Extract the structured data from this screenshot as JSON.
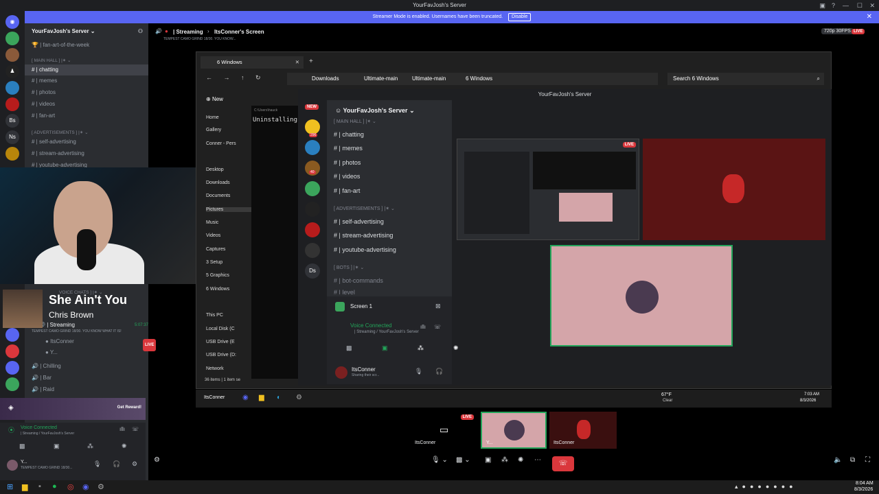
{
  "window": {
    "title": "YourFavJosh's Server"
  },
  "banner": {
    "text": "Streamer Mode is enabled. Usernames have been truncated.",
    "button": "Disable"
  },
  "rail": {
    "items": [
      "Bs",
      "Ns"
    ]
  },
  "sidebar": {
    "server_name": "YourFavJosh's Server",
    "top_channel": "fan-art-of-the-week",
    "cat_main": "[ MAIN HALL ] |✶ ⌄",
    "channels_main": [
      "chatting",
      "memes",
      "photos",
      "videos",
      "fan-art"
    ],
    "cat_ads": "[ ADVERTISEMENTS ] |✶ ⌄",
    "channels_ads": [
      "self-advertising",
      "stream-advertising",
      "youtube-advertising"
    ],
    "cat_voice": "VOICE CHATS ] |✶ ⌄",
    "voice_streaming": "| Streaming",
    "voice_streaming_time": "5:07:37",
    "voice_streaming_sub": "TEMPEST CAMO GRIND 18/30. YOU KNOW WHAT IT IS!",
    "voice_user1": "ItsConner",
    "voice_user2": "Y...",
    "voice_others": [
      "| Chilling",
      "| Bar",
      "| Raid"
    ],
    "get_reward": "Get Reward!",
    "voice_connected": "Voice Connected",
    "voice_sub": "| Streaming / YourFavJosh's Server",
    "user_name": "Y...",
    "user_status": "TEMPEST CAMO GRIND 18/30..."
  },
  "topbar": {
    "channel": "| Streaming",
    "screen": "ItsConner's Screen",
    "sub": "TEMPEST CAMO GRIND 18/30. YOU KNOW...",
    "quality": "720p 30FPS",
    "live": "LIVE"
  },
  "nowplaying": {
    "title": "She Ain't You",
    "artist": "Chris Brown"
  },
  "explorer": {
    "tab": "6 Windows",
    "crumbs": [
      "Downloads",
      "Ultimate-main",
      "Ultimate-main",
      "6 Windows"
    ],
    "search": "Search 6 Windows",
    "new": "New",
    "nav": [
      "Home",
      "Gallery",
      "Conner - Pers",
      "Desktop",
      "Downloads",
      "Documents",
      "Pictures",
      "Music",
      "Videos",
      "Captures",
      "3 Setup",
      "5 Graphics",
      "6 Windows",
      "This PC",
      "Local Disk (C",
      "USB Drive (E",
      "USB Drive (D:",
      "Network"
    ],
    "status": "36 items  |  1 item se",
    "terminal_path": "C:\\Users\\hauck",
    "terminal": "Uninstalling"
  },
  "inner": {
    "title": "YourFavJosh's Server",
    "server_name": "YourFavJosh's Server",
    "new_badge": "NEW",
    "badge1": "296",
    "badge2": "40",
    "rail_text": "Ds",
    "cat_main": "[ MAIN HALL ] |✶ ⌄",
    "channels_main": [
      "chatting",
      "memes",
      "photos",
      "videos",
      "fan-art"
    ],
    "cat_ads": "[ ADVERTISEMENTS ] |✶ ⌄",
    "channels_ads": [
      "self-advertising",
      "stream-advertising",
      "youtube-advertising"
    ],
    "cat_bots": "[ BOTS ] |✶ ⌄",
    "channels_bots": [
      "bot-commands",
      "level"
    ],
    "screen": "Screen 1",
    "voice_connected": "Voice Connected",
    "voice_sub": "| Streaming / YourFavJosh's Server",
    "user": "ItsConner",
    "user_sub": "Sharing their scr..."
  },
  "taskbar2": {
    "app": "ItsConner",
    "weather": "67°F",
    "weather_sub": "Clear",
    "time": "7:03 AM",
    "date": "8/3/2026"
  },
  "strip": {
    "t1": "ItsConner",
    "t2": "Y...",
    "t3": "ItsConner",
    "live": "LIVE"
  },
  "wtask": {
    "time": "8:04 AM",
    "date": "8/3/2026"
  },
  "colors": {
    "accent": "#5865f2",
    "live": "#da373c",
    "green": "#23a55a",
    "pink": "#d4a5a9",
    "maroon": "#5a1414"
  }
}
